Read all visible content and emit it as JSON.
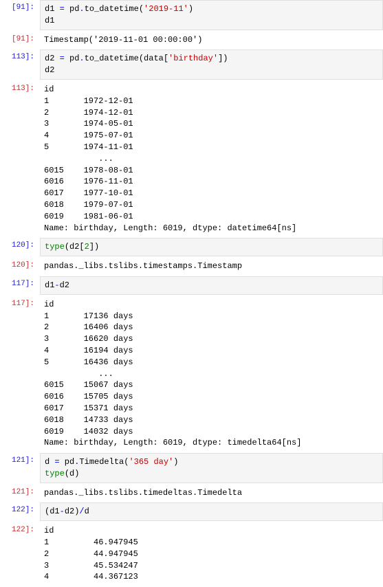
{
  "cells": [
    {
      "prompt": "[91]:",
      "type": "in",
      "code_tokens": [
        {
          "t": "d1 ",
          "c": ""
        },
        {
          "t": "=",
          "c": "c-blue"
        },
        {
          "t": " pd",
          "c": ""
        },
        {
          "t": ".",
          "c": "c-blue"
        },
        {
          "t": "to_datetime(",
          "c": ""
        },
        {
          "t": "'2019-11'",
          "c": "c-str"
        },
        {
          "t": ")\nd1",
          "c": ""
        }
      ]
    },
    {
      "prompt": "[91]:",
      "type": "out",
      "text": "Timestamp('2019-11-01 00:00:00')"
    },
    {
      "prompt": "113]:",
      "type": "in",
      "code_tokens": [
        {
          "t": "d2 ",
          "c": ""
        },
        {
          "t": "=",
          "c": "c-blue"
        },
        {
          "t": " pd",
          "c": ""
        },
        {
          "t": ".",
          "c": "c-blue"
        },
        {
          "t": "to_datetime(data[",
          "c": ""
        },
        {
          "t": "'birthday'",
          "c": "c-str"
        },
        {
          "t": "])\nd2",
          "c": ""
        }
      ]
    },
    {
      "prompt": "113]:",
      "type": "out",
      "text": "id\n1       1972-12-01\n2       1974-12-01\n3       1974-05-01\n4       1975-07-01\n5       1974-11-01\n           ...\n6015    1978-08-01\n6016    1976-11-01\n6017    1977-10-01\n6018    1979-07-01\n6019    1981-06-01\nName: birthday, Length: 6019, dtype: datetime64[ns]"
    },
    {
      "prompt": "120]:",
      "type": "in",
      "code_tokens": [
        {
          "t": "type",
          "c": "c-func-green"
        },
        {
          "t": "(d2[",
          "c": ""
        },
        {
          "t": "2",
          "c": "c-func-green"
        },
        {
          "t": "])",
          "c": ""
        }
      ]
    },
    {
      "prompt": "120]:",
      "type": "out",
      "text": "pandas._libs.tslibs.timestamps.Timestamp"
    },
    {
      "prompt": "117]:",
      "type": "in",
      "code_tokens": [
        {
          "t": "d1",
          "c": ""
        },
        {
          "t": "-",
          "c": "c-blue"
        },
        {
          "t": "d2",
          "c": ""
        }
      ]
    },
    {
      "prompt": "117]:",
      "type": "out",
      "text": "id\n1       17136 days\n2       16406 days\n3       16620 days\n4       16194 days\n5       16436 days\n           ...\n6015    15067 days\n6016    15705 days\n6017    15371 days\n6018    14733 days\n6019    14032 days\nName: birthday, Length: 6019, dtype: timedelta64[ns]"
    },
    {
      "prompt": "121]:",
      "type": "in",
      "code_tokens": [
        {
          "t": "d ",
          "c": ""
        },
        {
          "t": "=",
          "c": "c-blue"
        },
        {
          "t": " pd",
          "c": ""
        },
        {
          "t": ".",
          "c": "c-blue"
        },
        {
          "t": "Timedelta(",
          "c": ""
        },
        {
          "t": "'365 day'",
          "c": "c-str"
        },
        {
          "t": ")\n",
          "c": ""
        },
        {
          "t": "type",
          "c": "c-func-green"
        },
        {
          "t": "(d)",
          "c": ""
        }
      ]
    },
    {
      "prompt": "121]:",
      "type": "out",
      "text": "pandas._libs.tslibs.timedeltas.Timedelta"
    },
    {
      "prompt": "122]:",
      "type": "in",
      "code_tokens": [
        {
          "t": "(d1",
          "c": ""
        },
        {
          "t": "-",
          "c": "c-blue"
        },
        {
          "t": "d2)",
          "c": ""
        },
        {
          "t": "/",
          "c": "c-blue"
        },
        {
          "t": "d",
          "c": ""
        }
      ]
    },
    {
      "prompt": "122]:",
      "type": "out",
      "text": "id\n1         46.947945\n2         44.947945\n3         45.534247\n4         44.367123"
    }
  ]
}
